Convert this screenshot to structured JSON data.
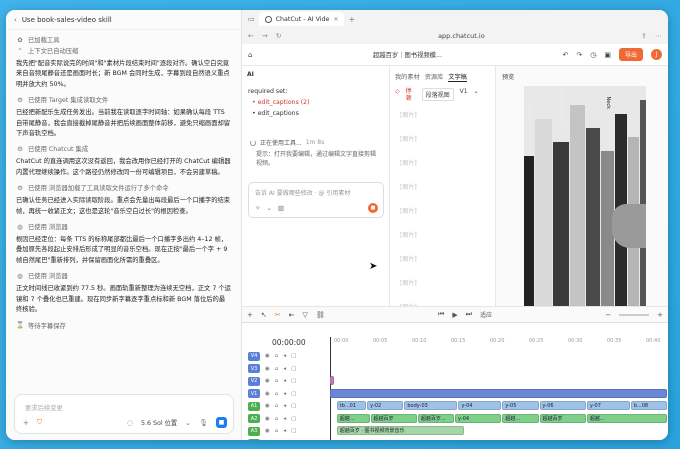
{
  "chat": {
    "title": "Use book-sales-video skill",
    "blocks": [
      {
        "type": "tool",
        "icon": "brain-icon",
        "text": "已加载工具"
      },
      {
        "type": "tool",
        "icon": "chevron-up-icon",
        "text": "上下文已自动压缩"
      },
      {
        "type": "para",
        "text": "我先把\"配音实际说完的时间\"和\"素材片段结束时间\"逐段对齐。确认空白究竟来自音频尾静音还是画面时长；新 BGM 会同时生成，字幕到段自然语义重点明并放大约 50%。"
      },
      {
        "type": "tool",
        "icon": "tool-icon",
        "text": "已使用 Target 集成读取文件"
      },
      {
        "type": "para",
        "text": "已经把新配乐生成任务发出。当前我在读取逐字时间轴：如果确认每段 TTS 自带尾静音，我会直接截掉尾静音并把后续画面整体前移，避免只缩画面却留下声音轨空档。"
      },
      {
        "type": "tool",
        "icon": "tool-icon",
        "text": "已使用 Chatcut 集成"
      },
      {
        "type": "para",
        "text": "ChatCut 的直连调用这次没有返回，我会改用你已经打开的 ChatCut 编辑器内置代理继续操作。这个路径仍然修改同一份可编辑项目，不会另建草稿。"
      },
      {
        "type": "tool",
        "icon": "tool-icon",
        "text": "已使用 浏览器加载了工具读取文件运行了多个命令"
      },
      {
        "type": "para",
        "text": "已确认任务已经进入实际读取阶段。重点会先量出每段最后一个口播字的结束帧，再统一收紧正文；这也是这轮\"音乐空白过长\"的根因检查。"
      },
      {
        "type": "tool",
        "icon": "globe-icon",
        "text": "已使用 浏览器"
      },
      {
        "type": "para",
        "text": "根因已经定位：每条 TTS 的标称尾部都比最后一个口播字多出约 4–12 帧，叠加原先各段起止安排后形成了明显的音乐空档。现在正按\"最后一个字 + 9 帧自然尾巴\"重新排列，并保留画面化所需的重叠区。"
      },
      {
        "type": "tool",
        "icon": "globe-icon",
        "text": "已使用 浏览器"
      },
      {
        "type": "para",
        "text": "正文时间线已收紧到约 77.5 秒。画面轨重新整理为连续无空档，正文 7 个运镜和 7 个叠化也已重建。现在同步新字幕逐字重点标和新 BGM 落位后的最终核验。"
      },
      {
        "type": "tool",
        "icon": "hourglass-icon",
        "text": "等待字幕保存"
      }
    ],
    "composer": {
      "placeholder": "要求后续变更",
      "model": "5.6 Sol 位置",
      "icons": [
        "plus-icon",
        "shield-icon",
        "spinner-icon",
        "chevron-down-icon",
        "mic-icon",
        "send-icon"
      ]
    }
  },
  "browser": {
    "tab_title": "ChatCut - AI Vide",
    "url": "app.chatcut.io",
    "project_title": "超越百岁｜图书视频模...",
    "export_label": "导出",
    "avatar_letter": "J"
  },
  "ai_panel": {
    "label": "AI",
    "lines": [
      {
        "text": "required set:",
        "color": "dark"
      },
      {
        "text": "edit_captions (2)",
        "color": "red"
      },
      {
        "text": "edit_captions",
        "color": "dark"
      }
    ],
    "status": "正在使用工具...",
    "status_time": "1m 8s",
    "hint": "提示：打开我要编辑，通过编辑文字直接剪辑视频。",
    "input_placeholder": "告诉 AI 要做哪些修改 · @ 引用素材"
  },
  "text_panel": {
    "tabs": [
      "我的素材",
      "资源库",
      "文字稿"
    ],
    "active_tab": "文字稿",
    "lock_label": "停顿",
    "view_label": "段落视图",
    "version_label": "V1",
    "placeholders": [
      "[图片]",
      "[图片]",
      "[图片]",
      "[图片]",
      "[图片]",
      "[图片]",
      "[图片]",
      "[图片]",
      "[图片]"
    ]
  },
  "preview": {
    "label": "预览",
    "book_titles": [
      "AMORES",
      "TRUE WISDOM",
      "Bye Bye Teleuse",
      "Diabolm",
      "Gone",
      "Neck"
    ]
  },
  "player": {
    "zoom": "适应"
  },
  "timeline": {
    "timecode": "00:00:00",
    "ruler_ticks": [
      "00:00",
      "00:05",
      "00:10",
      "00:15",
      "00:20",
      "00:25",
      "00:30",
      "00:35",
      "00:40"
    ],
    "tracks": [
      {
        "id": "V4",
        "color": "#5b7fd8",
        "clips": []
      },
      {
        "id": "V3",
        "color": "#5b7fd8",
        "clips": []
      },
      {
        "id": "V2",
        "color": "#5b7fd8",
        "clips": [
          {
            "label": "",
            "color": "#c77bc4",
            "start": 0,
            "end": 1.5
          }
        ]
      },
      {
        "id": "V1",
        "color": "#5b7fd8",
        "clips": [
          {
            "label": "",
            "color": "#6b86d6",
            "start": 0,
            "end": 100
          }
        ]
      },
      {
        "id": "A1",
        "color": "#4caf50",
        "clips": [
          {
            "label": "tb...01",
            "color": "#9fc2e8",
            "start": 2,
            "end": 11
          },
          {
            "label": "y-02",
            "color": "#9fc2e8",
            "start": 11,
            "end": 22
          },
          {
            "label": "body-03",
            "color": "#9fc2e8",
            "start": 22,
            "end": 38
          },
          {
            "label": "y-04",
            "color": "#9fc2e8",
            "start": 38,
            "end": 51
          },
          {
            "label": "y-05",
            "color": "#9fc2e8",
            "start": 51,
            "end": 62
          },
          {
            "label": "y-06",
            "color": "#9fc2e8",
            "start": 62,
            "end": 76
          },
          {
            "label": "y-07",
            "color": "#9fc2e8",
            "start": 76,
            "end": 89
          },
          {
            "label": "b...08",
            "color": "#9fc2e8",
            "start": 89,
            "end": 100
          }
        ]
      },
      {
        "id": "A2",
        "color": "#4caf50",
        "clips": [
          {
            "label": "超越...",
            "color": "#7ecf8a",
            "start": 2,
            "end": 12
          },
          {
            "label": "超越百岁",
            "color": "#7ecf8a",
            "start": 12,
            "end": 26
          },
          {
            "label": "超越百岁...",
            "color": "#7ecf8a",
            "start": 26,
            "end": 37
          },
          {
            "label": "y-04",
            "color": "#7ecf8a",
            "start": 37,
            "end": 51
          },
          {
            "label": "超越...",
            "color": "#7ecf8a",
            "start": 51,
            "end": 62
          },
          {
            "label": "超越百岁",
            "color": "#7ecf8a",
            "start": 62,
            "end": 76
          },
          {
            "label": "超越...",
            "color": "#7ecf8a",
            "start": 76,
            "end": 100
          }
        ]
      },
      {
        "id": "A3",
        "color": "#4caf50",
        "clips": [
          {
            "label": "超越百岁 · 图书视频背景音乐",
            "color": "#a5d6a7",
            "start": 2,
            "end": 40
          }
        ]
      },
      {
        "id": "A4",
        "color": "#4caf50",
        "clips": []
      }
    ]
  }
}
